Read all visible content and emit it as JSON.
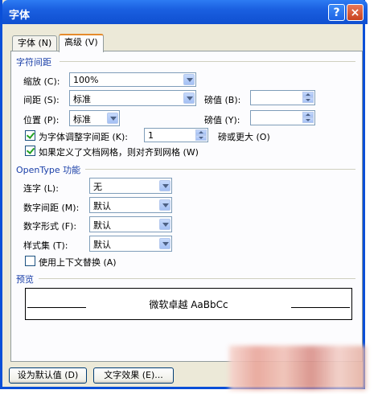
{
  "window": {
    "title": "字体",
    "help_glyph": "?",
    "close_glyph": "×"
  },
  "tabs": [
    {
      "label": "字体 (N)",
      "active": false
    },
    {
      "label": "高级 (V)",
      "active": true
    }
  ],
  "char_spacing": {
    "title": "字符间距",
    "scale": {
      "label": "缩放 (C):",
      "value": "100%"
    },
    "spacing": {
      "label": "间距 (S):",
      "value": "标准",
      "pt_label": "磅值 (B):",
      "pt_value": ""
    },
    "position": {
      "label": "位置 (P):",
      "value": "标准",
      "pt_label": "磅值 (Y):",
      "pt_value": ""
    },
    "kerning": {
      "label": "为字体调整字间距 (K):",
      "value": "1",
      "suffix": "磅或更大 (O)",
      "checked": true
    },
    "grid": {
      "label": "如果定义了文档网格，则对齐到网格 (W)",
      "checked": true
    }
  },
  "opentype": {
    "title": "OpenType 功能",
    "ligatures": {
      "label": "连字 (L):",
      "value": "无"
    },
    "number_spacing": {
      "label": "数字间距 (M):",
      "value": "默认"
    },
    "number_forms": {
      "label": "数字形式 (F):",
      "value": "默认"
    },
    "stylistic_sets": {
      "label": "样式集 (T):",
      "value": "默认"
    },
    "contextual": {
      "label": "使用上下文替换 (A)",
      "checked": false
    }
  },
  "preview": {
    "title": "预览",
    "text": "微软卓越 AaBbCc"
  },
  "buttons": {
    "set_default": "设为默认值 (D)",
    "text_effects": "文字效果 (E)..."
  }
}
